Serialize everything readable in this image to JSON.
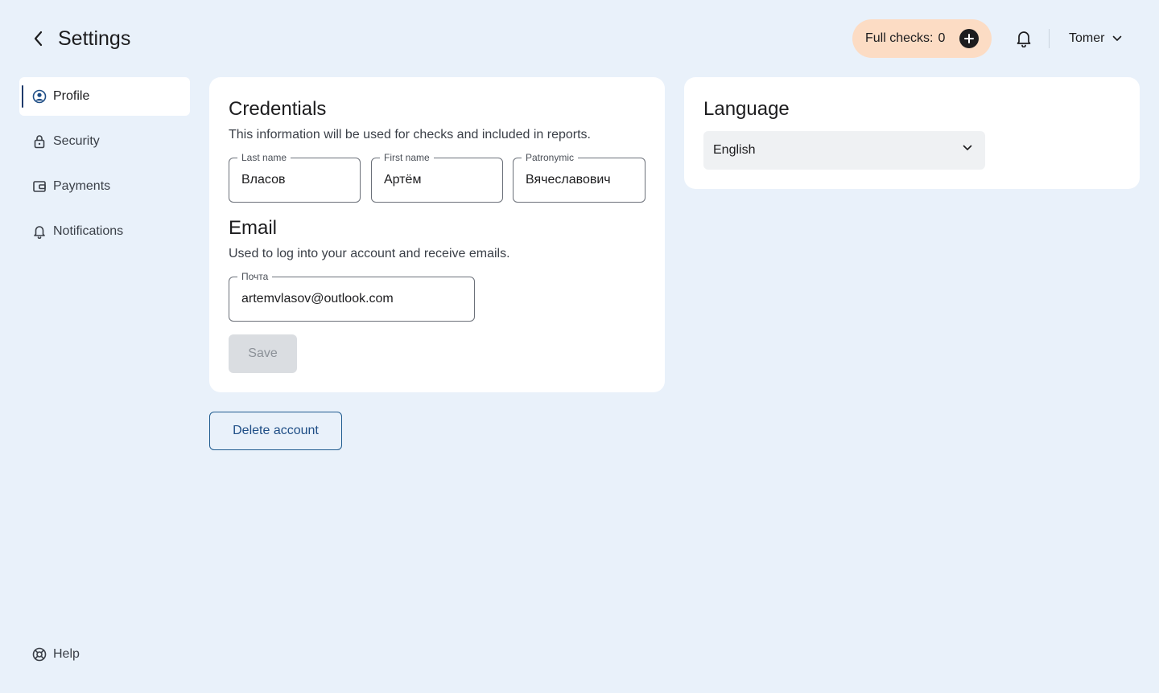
{
  "header": {
    "title": "Settings",
    "checks_label": "Full checks:",
    "checks_count": "0",
    "user_name": "Tomer"
  },
  "sidebar": {
    "items": [
      {
        "label": "Profile",
        "icon": "user-circle-icon",
        "active": true
      },
      {
        "label": "Security",
        "icon": "lock-icon"
      },
      {
        "label": "Payments",
        "icon": "wallet-icon"
      },
      {
        "label": "Notifications",
        "icon": "bell-icon"
      }
    ],
    "help_label": "Help"
  },
  "credentials": {
    "title": "Credentials",
    "description": "This information will be used for checks and included in reports.",
    "last_name": {
      "label": "Last name",
      "value": "Власов"
    },
    "first_name": {
      "label": "First name",
      "value": "Артём"
    },
    "patronymic": {
      "label": "Patronymic",
      "value": "Вячеславович"
    }
  },
  "email": {
    "title": "Email",
    "description": "Used to log into your account and receive emails.",
    "field": {
      "label": "Почта",
      "value": "artemvlasov@outlook.com"
    }
  },
  "actions": {
    "save_label": "Save",
    "delete_label": "Delete account"
  },
  "language": {
    "title": "Language",
    "selected": "English"
  },
  "colors": {
    "background": "#e9f1fa",
    "pill": "#fcdcc4",
    "accent": "#1f4e86"
  }
}
